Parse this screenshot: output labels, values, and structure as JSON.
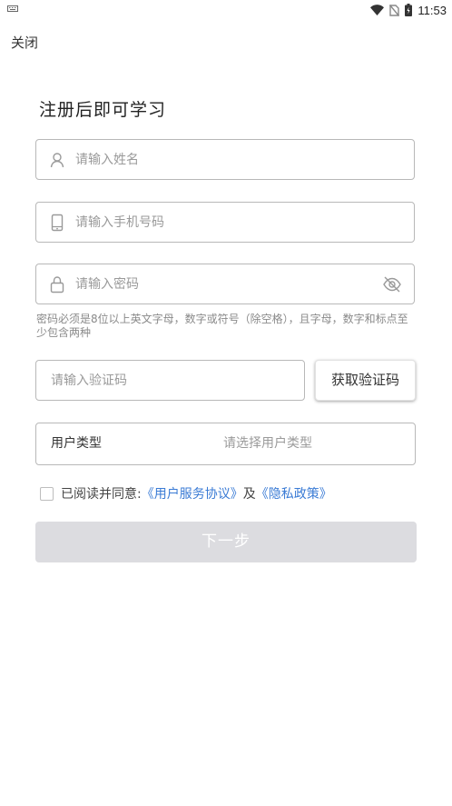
{
  "status_bar": {
    "time": "11:53",
    "icons": [
      "keyboard-icon",
      "wifi-icon",
      "no-sim-icon",
      "battery-icon"
    ]
  },
  "header": {
    "close_label": "关闭"
  },
  "page": {
    "title": "注册后即可学习"
  },
  "form": {
    "name_placeholder": "请输入姓名",
    "phone_placeholder": "请输入手机号码",
    "password_placeholder": "请输入密码",
    "password_hint": "密码必须是8位以上英文字母，数字或符号（除空格），且字母，数字和标点至少包含两种",
    "code_placeholder": "请输入验证码",
    "get_code_label": "获取验证码",
    "user_type_label": "用户类型",
    "user_type_placeholder": "请选择用户类型"
  },
  "agreement": {
    "prefix": "已阅读并同意:",
    "service_link": "《用户服务协议》",
    "and": "及",
    "privacy_link": "《隐私政策》",
    "checked": false
  },
  "actions": {
    "next_label": "下一步"
  },
  "colors": {
    "link": "#3a7bd5",
    "disabled_button": "#dcdce0",
    "border": "#b8b8b8",
    "placeholder": "#9a9a9a"
  }
}
